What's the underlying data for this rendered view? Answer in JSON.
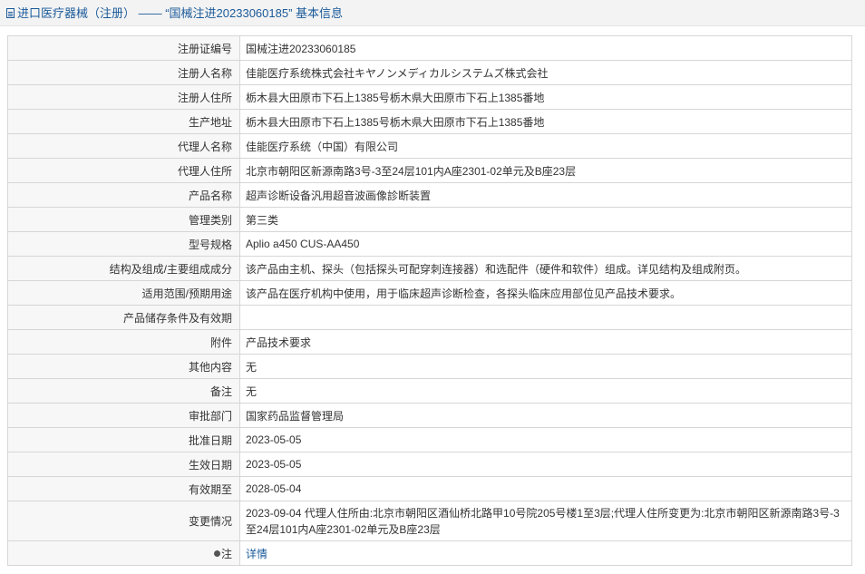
{
  "header": {
    "title": "进口医疗器械（注册） —— “国械注进20233060185” 基本信息"
  },
  "rows": [
    {
      "label": "注册证编号",
      "value": "国械注进20233060185"
    },
    {
      "label": "注册人名称",
      "value": "佳能医疗系统株式会社キヤノンメディカルシステムズ株式会社"
    },
    {
      "label": "注册人住所",
      "value": "栃木县大田原市下石上1385号栃木県大田原市下石上1385番地"
    },
    {
      "label": "生产地址",
      "value": "栃木县大田原市下石上1385号栃木県大田原市下石上1385番地"
    },
    {
      "label": "代理人名称",
      "value": "佳能医疗系统（中国）有限公司"
    },
    {
      "label": "代理人住所",
      "value": "北京市朝阳区新源南路3号-3至24层101内A座2301-02单元及B座23层"
    },
    {
      "label": "产品名称",
      "value": "超声诊断设备汎用超音波画像診断装置"
    },
    {
      "label": "管理类别",
      "value": "第三类"
    },
    {
      "label": "型号规格",
      "value": "Aplio a450 CUS-AA450"
    },
    {
      "label": "结构及组成/主要组成成分",
      "value": "该产品由主机、探头（包括探头可配穿刺连接器）和选配件（硬件和软件）组成。详见结构及组成附页。"
    },
    {
      "label": "适用范围/预期用途",
      "value": "该产品在医疗机构中使用，用于临床超声诊断检查，各探头临床应用部位见产品技术要求。"
    },
    {
      "label": "产品储存条件及有效期",
      "value": ""
    },
    {
      "label": "附件",
      "value": "产品技术要求"
    },
    {
      "label": "其他内容",
      "value": "无"
    },
    {
      "label": "备注",
      "value": "无"
    },
    {
      "label": "审批部门",
      "value": "国家药品监督管理局"
    },
    {
      "label": "批准日期",
      "value": "2023-05-05"
    },
    {
      "label": "生效日期",
      "value": "2023-05-05"
    },
    {
      "label": "有效期至",
      "value": "2028-05-04"
    }
  ],
  "change": {
    "label": "变更情况",
    "value": "2023-09-04 代理人住所由:北京市朝阳区酒仙桥北路甲10号院205号楼1至3层;代理人住所变更为:北京市朝阳区新源南路3号-3至24层101内A座2301-02单元及B座23层"
  },
  "note": {
    "label": "注",
    "link_text": "详情"
  }
}
